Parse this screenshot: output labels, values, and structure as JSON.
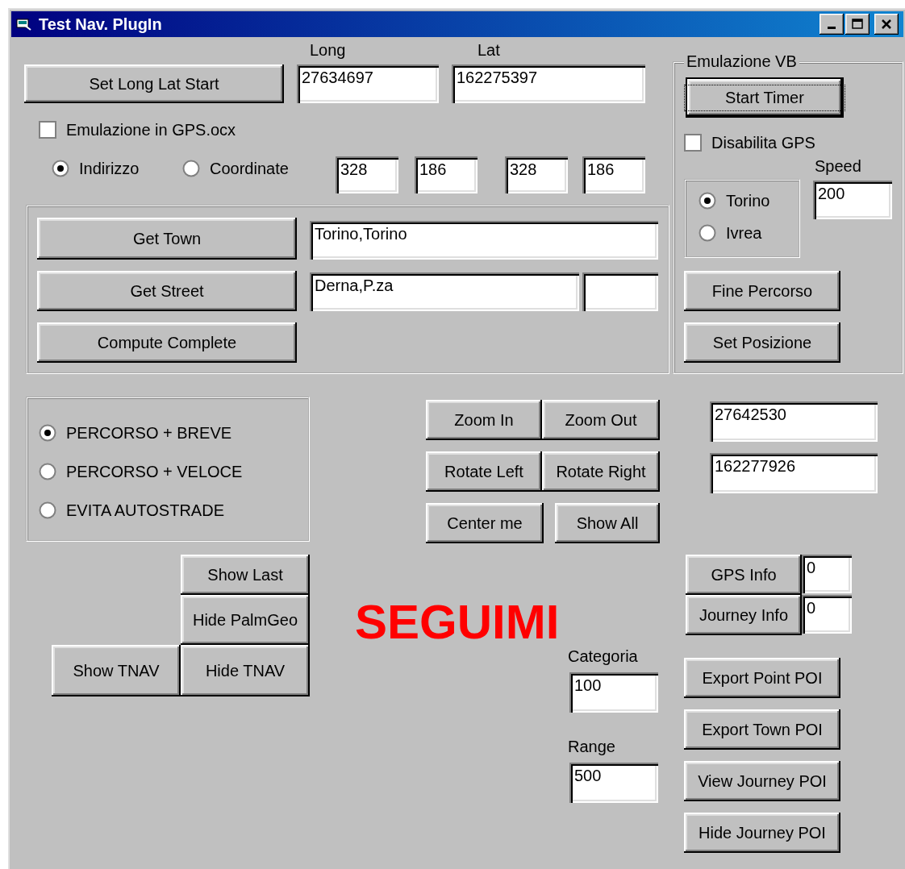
{
  "window": {
    "title": "Test Nav. PlugIn"
  },
  "controls": [
    {
      "kind": "label",
      "text": "Long"
    },
    {
      "kind": "label",
      "text": "Lat"
    },
    {
      "kind": "button",
      "text": "Set Long Lat Start",
      "focused": false
    },
    {
      "kind": "textbox",
      "value": "27634697"
    },
    {
      "kind": "textbox",
      "value": "162275397"
    },
    {
      "kind": "checkbox",
      "text": "Emulazione in GPS.ocx",
      "checked": false
    },
    {
      "kind": "radio",
      "text": "Indirizzo",
      "selected": true
    },
    {
      "kind": "radio",
      "text": "Coordinate",
      "selected": false
    },
    {
      "kind": "textbox",
      "value": "328"
    },
    {
      "kind": "textbox",
      "value": "186"
    },
    {
      "kind": "textbox",
      "value": "328"
    },
    {
      "kind": "textbox",
      "value": "186"
    },
    {
      "kind": "frame"
    },
    {
      "kind": "button",
      "text": "Get Town",
      "focused": false
    },
    {
      "kind": "textbox",
      "value": "Torino,Torino"
    },
    {
      "kind": "button",
      "text": "Get Street",
      "focused": false
    },
    {
      "kind": "textbox",
      "value": "Derna,P.za"
    },
    {
      "kind": "textbox"
    },
    {
      "kind": "button",
      "text": "Compute Complete",
      "focused": false
    },
    {
      "kind": "frame",
      "title": "Emulazione VB"
    },
    {
      "kind": "button",
      "text": "Start Timer",
      "focused": true
    },
    {
      "kind": "checkbox",
      "text": "Disabilita GPS",
      "checked": false
    },
    {
      "kind": "label",
      "text": "Speed"
    },
    {
      "kind": "frame"
    },
    {
      "kind": "radio",
      "text": "Torino",
      "selected": true
    },
    {
      "kind": "radio",
      "text": "Ivrea",
      "selected": false
    },
    {
      "kind": "textbox",
      "value": "200"
    },
    {
      "kind": "button",
      "text": "Fine Percorso",
      "focused": false
    },
    {
      "kind": "button",
      "text": "Set Posizione",
      "focused": false
    },
    {
      "kind": "frame"
    },
    {
      "kind": "radio",
      "text": "PERCORSO + BREVE",
      "selected": true
    },
    {
      "kind": "radio",
      "text": "PERCORSO + VELOCE",
      "selected": false
    },
    {
      "kind": "radio",
      "text": "EVITA AUTOSTRADE",
      "selected": false
    },
    {
      "kind": "button",
      "text": "Zoom In",
      "focused": false
    },
    {
      "kind": "button",
      "text": "Zoom Out",
      "focused": false
    },
    {
      "kind": "textbox",
      "value": "27642530"
    },
    {
      "kind": "button",
      "text": "Rotate Left",
      "focused": false
    },
    {
      "kind": "button",
      "text": "Rotate Right",
      "focused": false
    },
    {
      "kind": "textbox",
      "value": "162277926"
    },
    {
      "kind": "button",
      "text": "Center me",
      "focused": false
    },
    {
      "kind": "button",
      "text": "Show All",
      "focused": false
    },
    {
      "kind": "button",
      "text": "Show Last",
      "focused": false
    },
    {
      "kind": "button",
      "text": "GPS Info",
      "focused": false
    },
    {
      "kind": "textbox",
      "value": "0"
    },
    {
      "kind": "button",
      "text": "Hide PalmGeo",
      "focused": false
    },
    {
      "kind": "headline",
      "text": "SEGUIMI"
    },
    {
      "kind": "button",
      "text": "Journey Info",
      "focused": false
    },
    {
      "kind": "textbox",
      "value": "0"
    },
    {
      "kind": "label",
      "text": "Categoria"
    },
    {
      "kind": "button",
      "text": "Show TNAV",
      "focused": false
    },
    {
      "kind": "button",
      "text": "Hide TNAV",
      "focused": false
    },
    {
      "kind": "textbox",
      "value": "100"
    },
    {
      "kind": "button",
      "text": "Export Point POI",
      "focused": false
    },
    {
      "kind": "button",
      "text": "Export Town POI",
      "focused": false
    },
    {
      "kind": "label",
      "text": "Range"
    },
    {
      "kind": "textbox",
      "value": "500"
    },
    {
      "kind": "button",
      "text": "View Journey POI",
      "focused": false
    },
    {
      "kind": "button",
      "text": "Hide Journey POI",
      "focused": false
    }
  ]
}
